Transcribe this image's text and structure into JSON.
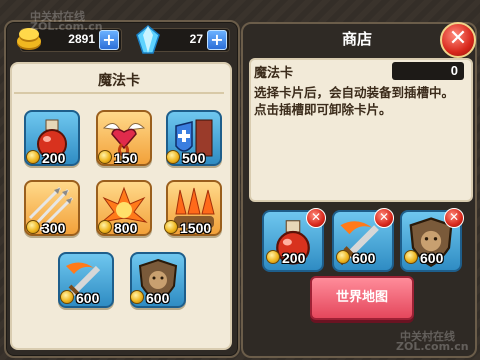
{
  "resources": {
    "gold": "2891",
    "gems": "27"
  },
  "left_panel": {
    "title": "魔法卡",
    "cards": [
      {
        "name": "potion",
        "price": "200",
        "style": "blue"
      },
      {
        "name": "winged-heart",
        "price": "150",
        "style": "orange"
      },
      {
        "name": "tower-shield",
        "price": "500",
        "style": "blue"
      },
      {
        "name": "arrows",
        "price": "300",
        "style": "orange"
      },
      {
        "name": "fire-burst",
        "price": "800",
        "style": "orange"
      },
      {
        "name": "fire-rain",
        "price": "1500",
        "style": "orange"
      },
      {
        "name": "flaming-sword",
        "price": "600",
        "style": "blue"
      },
      {
        "name": "shield-boar",
        "price": "600",
        "style": "blue"
      }
    ]
  },
  "right_panel": {
    "title": "商店",
    "info_title": "魔法卡",
    "counter": "0",
    "description": "选择卡片后，会自动装备到插槽中。点击插槽即可卸除卡片。",
    "slots": [
      {
        "name": "potion",
        "price": "200"
      },
      {
        "name": "flaming-sword",
        "price": "600"
      },
      {
        "name": "shield-boar",
        "price": "600"
      }
    ],
    "world_map_button": "世界地图"
  },
  "watermark": {
    "line1": "中关村在线",
    "line2": "ZOL.com.cn"
  },
  "icons": [
    "gold-coin-icon",
    "blue-gem-icon",
    "plus-icon",
    "close-icon",
    "remove-card-icon"
  ]
}
